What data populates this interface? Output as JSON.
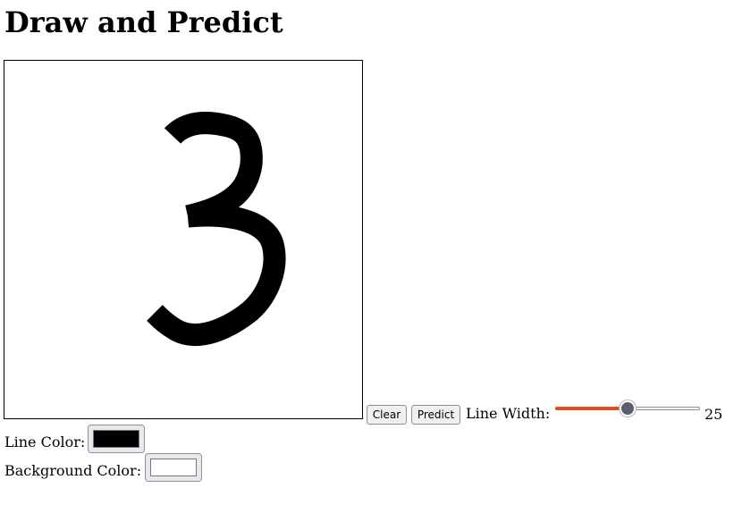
{
  "page": {
    "title": "Draw and Predict"
  },
  "canvas": {
    "drawn_digit": "3",
    "stroke_color": "#000000",
    "background_color": "#ffffff"
  },
  "controls": {
    "clear_label": "Clear",
    "predict_label": "Predict",
    "line_width_label": "Line Width:",
    "line_width_value": "25",
    "line_width_fraction": 0.5,
    "slider_accent": "#e04e1a",
    "slider_thumb_color": "#5c5c70",
    "line_color_label": "Line Color:",
    "line_color_value": "#000000",
    "background_color_label": "Background Color:",
    "background_color_value": "#ffffff"
  }
}
